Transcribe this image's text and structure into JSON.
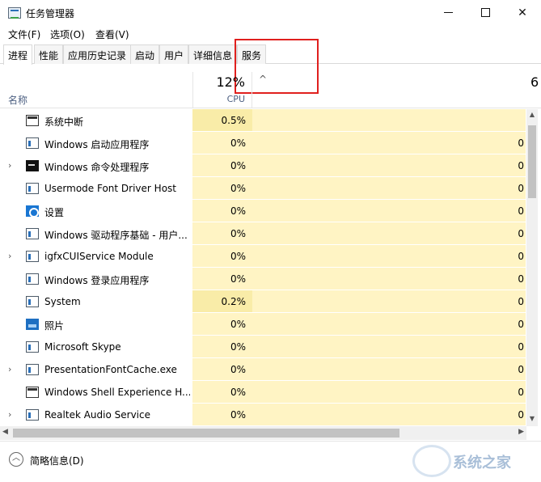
{
  "window": {
    "title": "任务管理器",
    "minimize": "—",
    "maximize": "☐",
    "close": "✕"
  },
  "menu": [
    "文件(F)",
    "选项(O)",
    "查看(V)"
  ],
  "tabs": [
    "进程",
    "性能",
    "应用历史记录",
    "启动",
    "用户",
    "详细信息",
    "服务"
  ],
  "active_tab": "进程",
  "header": {
    "name_label": "名称",
    "cpu_percent": "12%",
    "cpu_label": "CPU",
    "next_col_partial": "6"
  },
  "rows": [
    {
      "name": "系统中断",
      "cpu": "0.5%",
      "mem": "",
      "icon": "window-icon",
      "expandable": false
    },
    {
      "name": "Windows 启动应用程序",
      "cpu": "0%",
      "mem": "0",
      "icon": "app-icon",
      "expandable": false
    },
    {
      "name": "Windows 命令处理程序",
      "cpu": "0%",
      "mem": "0",
      "icon": "cmd-icon",
      "expandable": true
    },
    {
      "name": "Usermode Font Driver Host",
      "cpu": "0%",
      "mem": "0",
      "icon": "app-icon",
      "expandable": false
    },
    {
      "name": "设置",
      "cpu": "0%",
      "mem": "0",
      "icon": "gear-icon",
      "expandable": false
    },
    {
      "name": "Windows 驱动程序基础 - 用户...",
      "cpu": "0%",
      "mem": "0",
      "icon": "app-icon",
      "expandable": false
    },
    {
      "name": "igfxCUIService Module",
      "cpu": "0%",
      "mem": "0",
      "icon": "app-icon",
      "expandable": true
    },
    {
      "name": "Windows 登录应用程序",
      "cpu": "0%",
      "mem": "0",
      "icon": "app-icon",
      "expandable": false
    },
    {
      "name": "System",
      "cpu": "0.2%",
      "mem": "0",
      "icon": "app-icon",
      "expandable": false
    },
    {
      "name": "照片",
      "cpu": "0%",
      "mem": "0",
      "icon": "photo-icon",
      "expandable": false
    },
    {
      "name": "Microsoft Skype",
      "cpu": "0%",
      "mem": "0",
      "icon": "app-icon",
      "expandable": false
    },
    {
      "name": "PresentationFontCache.exe",
      "cpu": "0%",
      "mem": "0",
      "icon": "app-icon",
      "expandable": true
    },
    {
      "name": "Windows Shell Experience H...",
      "cpu": "0%",
      "mem": "0",
      "icon": "window-icon",
      "expandable": false
    },
    {
      "name": "Realtek Audio Service",
      "cpu": "0%",
      "mem": "0",
      "icon": "app-icon",
      "expandable": true
    }
  ],
  "footer": {
    "fewer_details": "简略信息(D)"
  },
  "watermark": "系统之家",
  "colors": {
    "cpu_cell": "#fff4c4",
    "cpu_cell_hot": "#f9eca8",
    "highlight_box": "#e0201e"
  }
}
